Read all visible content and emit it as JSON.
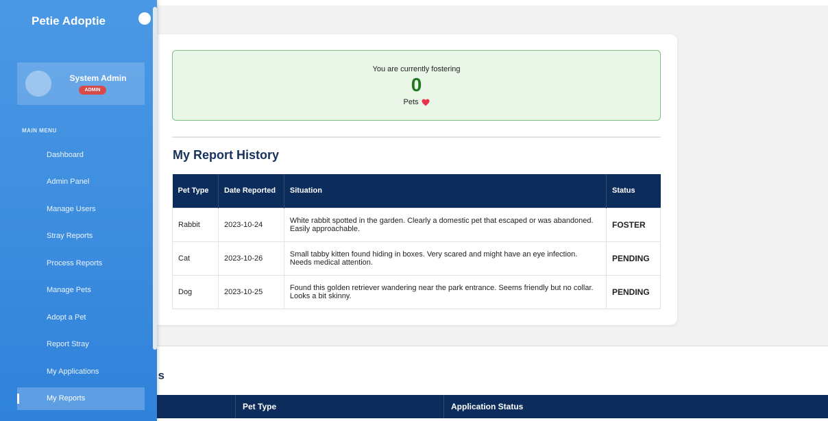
{
  "app": {
    "name": "Petie Adoptie"
  },
  "user": {
    "name": "System Admin",
    "role": "ADMIN"
  },
  "sidebar": {
    "section_label": "MAIN MENU",
    "items": [
      {
        "label": "Dashboard"
      },
      {
        "label": "Admin Panel"
      },
      {
        "label": "Manage Users"
      },
      {
        "label": "Stray Reports"
      },
      {
        "label": "Process Reports"
      },
      {
        "label": "Manage Pets"
      },
      {
        "label": "Adopt a Pet"
      },
      {
        "label": "Report Stray"
      },
      {
        "label": "My Applications"
      },
      {
        "label": "My Reports",
        "active": true
      }
    ]
  },
  "fostering": {
    "intro": "You are currently fostering",
    "count": "0",
    "unit": "Pets",
    "icon": "heart-icon"
  },
  "reports": {
    "title": "My Report History",
    "columns": [
      "Pet Type",
      "Date Reported",
      "Situation",
      "Status"
    ],
    "rows": [
      {
        "pet_type": "Rabbit",
        "date": "2023-10-24",
        "situation": "White rabbit spotted in the garden. Clearly a domestic pet that escaped or was abandoned. Easily approachable.",
        "status": "FOSTER"
      },
      {
        "pet_type": "Cat",
        "date": "2023-10-26",
        "situation": "Small tabby kitten found hiding in boxes. Very scared and might have an eye infection. Needs medical attention.",
        "status": "PENDING"
      },
      {
        "pet_type": "Dog",
        "date": "2023-10-25",
        "situation": "Found this golden retriever wandering near the park entrance. Seems friendly but no collar. Looks a bit skinny.",
        "status": "PENDING"
      }
    ]
  },
  "applications": {
    "title_visible": "s",
    "columns": [
      "",
      "Pet Type",
      "Application Status"
    ]
  },
  "colors": {
    "sidebar": "#3d8ddf",
    "table_header": "#0c2d5c",
    "status": "#f0a01a",
    "foster_count": "#1f7a1f",
    "heart": "#e8334a"
  }
}
